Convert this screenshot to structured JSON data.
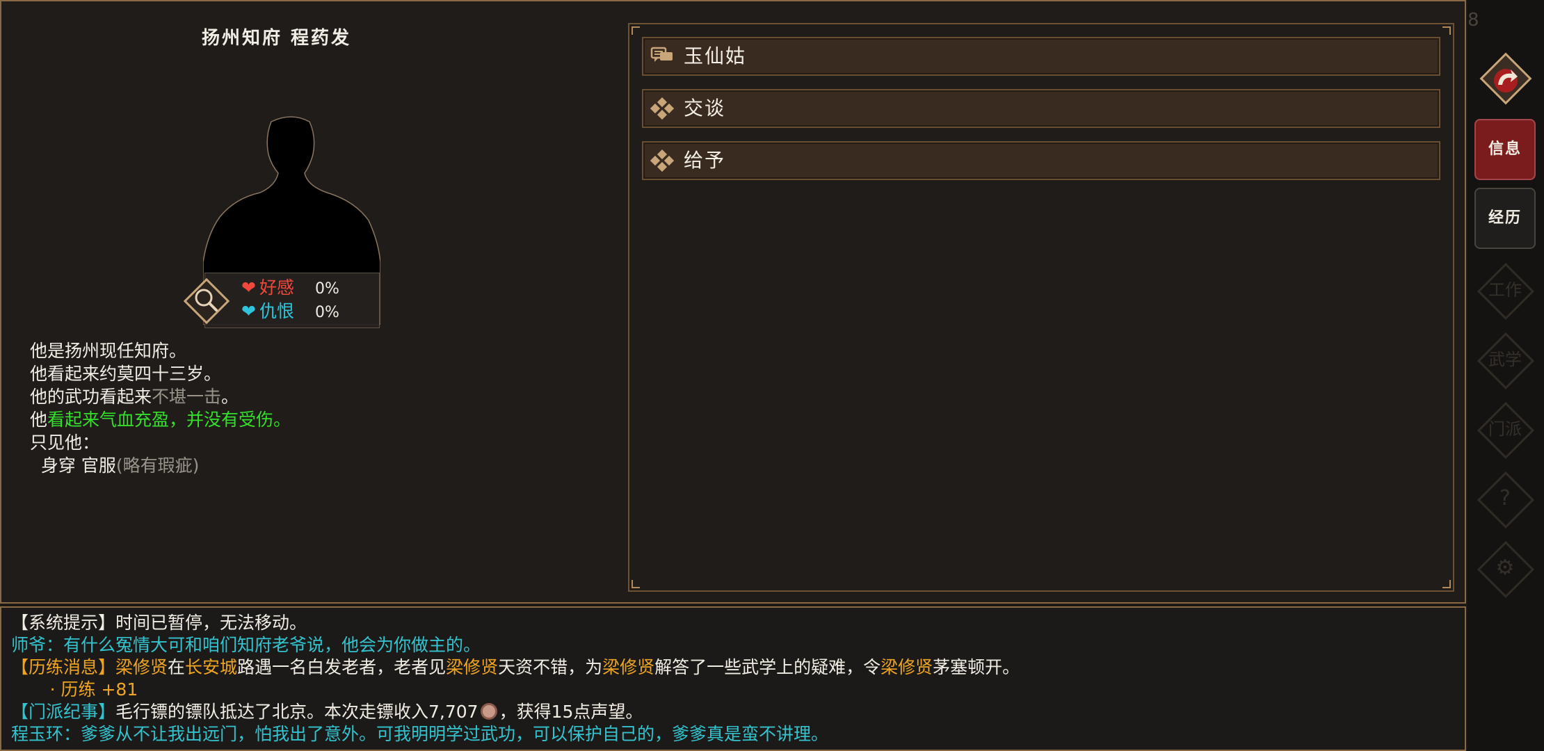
{
  "character": {
    "title": "扬州知府  程药发",
    "relations": {
      "favor_label": "好感",
      "favor_value": "0%",
      "hate_label": "仇恨",
      "hate_value": "0%"
    },
    "description": {
      "line1": "他是扬州现任知府。",
      "line2": "他看起来约莫四十三岁。",
      "line3_prefix": "他的武功看起来",
      "line3_grey": "不堪一击",
      "line3_suffix": "。",
      "line4_prefix": "他",
      "line4_green": "看起来气血充盈，并没有受伤。",
      "line5": "只见他：",
      "line6_prefix": "  身穿 官服",
      "line6_grey": "(略有瑕疵)"
    }
  },
  "options": [
    {
      "label": "玉仙姑",
      "icon": "speech-icon"
    },
    {
      "label": "交谈",
      "icon": "diamond-icon"
    },
    {
      "label": "给予",
      "icon": "diamond-icon"
    }
  ],
  "sidebar": {
    "top_number": "8",
    "info_label": "信息",
    "exp_label": "经历",
    "faded": [
      "工作",
      "武学",
      "门派",
      "?",
      "⚙"
    ]
  },
  "log": {
    "l1_a": "【系统提示】",
    "l1_b": "时间已暂停，无法移动。",
    "l2": "师爷：有什么冤情大可和咱们知府老爷说，他会为你做主的。",
    "l3_a": "【历练消息】",
    "l3_b": "梁修贤",
    "l3_c": "在",
    "l3_d": "长安城",
    "l3_e": "路遇一名白发老者，老者见",
    "l3_f": "梁修贤",
    "l3_g": "天资不错，为",
    "l3_h": "梁修贤",
    "l3_i": "解答了一些武学上的疑难，令",
    "l3_j": "梁修贤",
    "l3_k": "茅塞顿开。",
    "l4": "       · 历练 +81",
    "l5_a": "【门派纪事】",
    "l5_b": "毛行镖的镖队抵达了北京。本次走镖收入7,707",
    "l5_c": "，获得15点声望。",
    "l6": "程玉环：爹爹从不让我出远门，怕我出了意外。可我明明学过武功，可以保护自己的，爹爹真是蛮不讲理。"
  },
  "colors": {
    "accent_red": "#7a1c1e",
    "favor_red": "#f0493c",
    "hate_cyan": "#2fc4dc",
    "log_cyan": "#33c3cf",
    "log_orange": "#f0a522",
    "healthy_green": "#35e02a"
  }
}
